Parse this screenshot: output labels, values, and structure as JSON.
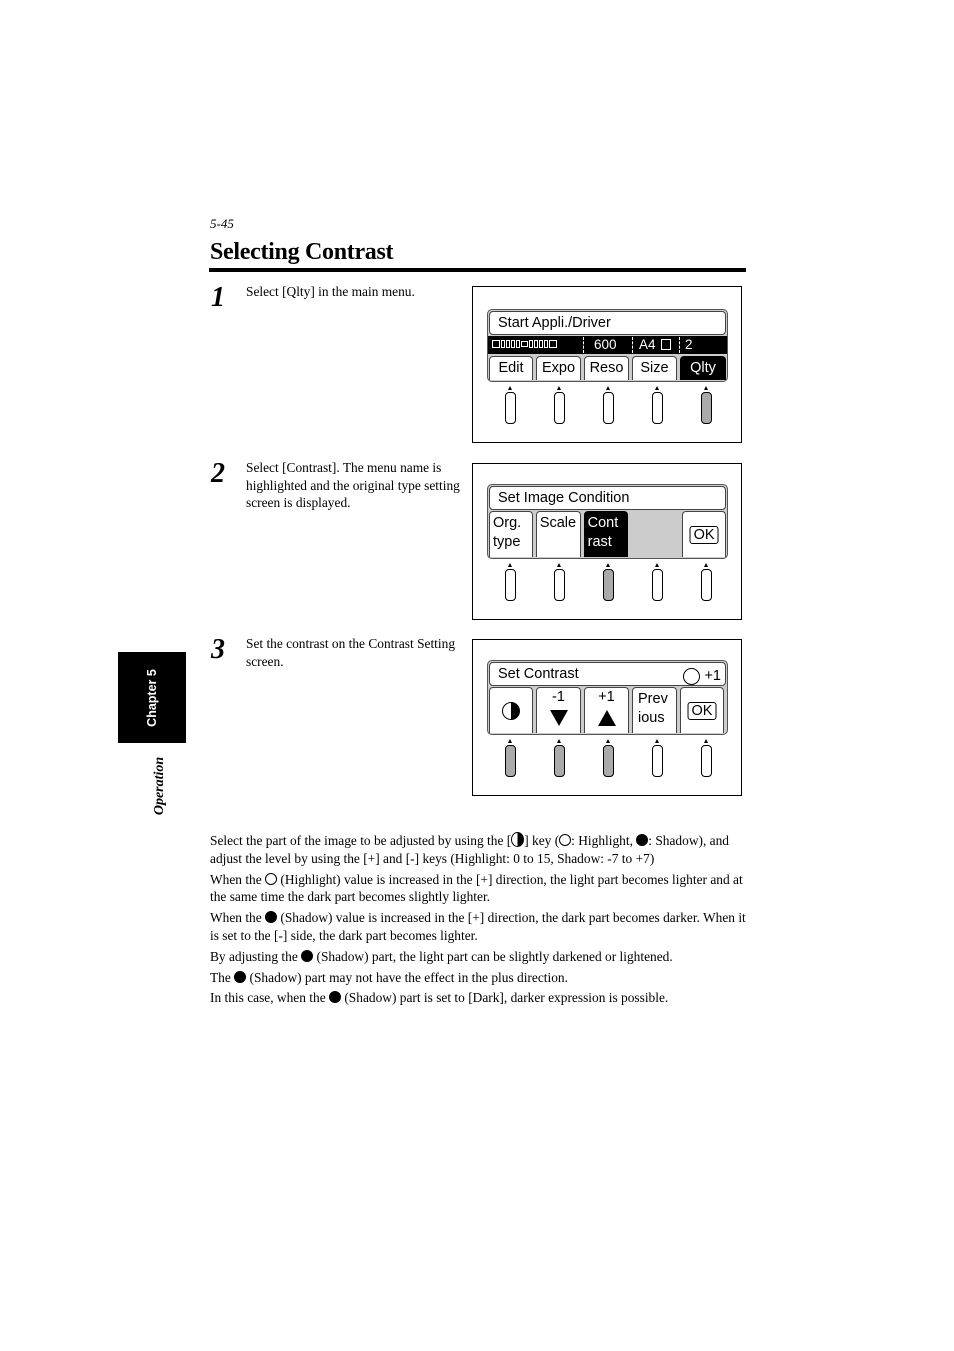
{
  "header": {
    "page_number": "5-45",
    "title": "Selecting Contrast"
  },
  "side_tab": {
    "chapter": "Chapter 5",
    "section": "Operation"
  },
  "steps": [
    {
      "number": "1",
      "text": "Select [Qlty] in the main menu.",
      "screen": {
        "title": "Start Appli./Driver",
        "status": {
          "resolution": "600",
          "paper": "A4",
          "copies": "2"
        },
        "tabs": [
          "Edit",
          "Expo",
          "Reso",
          "Size",
          "Qlty"
        ],
        "selected_tab": "Qlty",
        "keys_active": [
          false,
          false,
          false,
          false,
          true
        ]
      }
    },
    {
      "number": "2",
      "text": "Select [Contrast]. The menu name is highlighted and the original type setting screen is displayed.",
      "screen": {
        "title": "Set Image Condition",
        "tabs": [
          {
            "line1": "Org.",
            "line2": "type"
          },
          {
            "line1": "Scale",
            "line2": ""
          },
          {
            "line1": "Cont",
            "line2": "rast"
          },
          {
            "line1": "",
            "line2": ""
          },
          {
            "line1": "OK",
            "line2": ""
          }
        ],
        "selected_tab": "Contrast",
        "keys_active": [
          false,
          false,
          true,
          false,
          false
        ]
      }
    },
    {
      "number": "3",
      "text": "Set the contrast on the Contrast Setting screen.",
      "screen": {
        "title": "Set Contrast",
        "value": "+1",
        "value_icon": "highlight-circle-icon",
        "tabs": [
          {
            "icon": "half-circle-icon"
          },
          {
            "label": "-1",
            "icon": "triangle-down-icon"
          },
          {
            "label": "+1",
            "icon": "triangle-up-icon"
          },
          {
            "line1": "Prev",
            "line2": "ious"
          },
          {
            "label": "OK"
          }
        ],
        "keys_active": [
          true,
          true,
          true,
          false,
          false
        ]
      }
    }
  ],
  "body": {
    "p1": {
      "a": "Select the part of the image to be adjusted by using the [",
      "b": "]  key (",
      "c": ": Highlight, ",
      "d": ": Shadow), and adjust the level by using the [+] and [-] keys (Highlight: 0 to 15, Shadow: -7 to +7)"
    },
    "p2": {
      "a": "When the ",
      "b": " (Highlight) value is increased in the [+] direction, the light part becomes lighter and at the same time the dark part becomes slightly lighter."
    },
    "p3": {
      "a": "When the ",
      "b": " (Shadow) value is increased in the [+] direction, the dark part becomes darker. When it is set to the [-] side, the dark part becomes lighter."
    },
    "p4": {
      "a": "By adjusting the ",
      "b": " (Shadow) part, the light part can be slightly darkened or lightened."
    },
    "p5": {
      "a": "The ",
      "b": " (Shadow) part may not have the effect in the plus direction."
    },
    "p6": {
      "a": "In this case, when the ",
      "b": " (Shadow) part is set to [Dark], darker expression is possible."
    }
  }
}
